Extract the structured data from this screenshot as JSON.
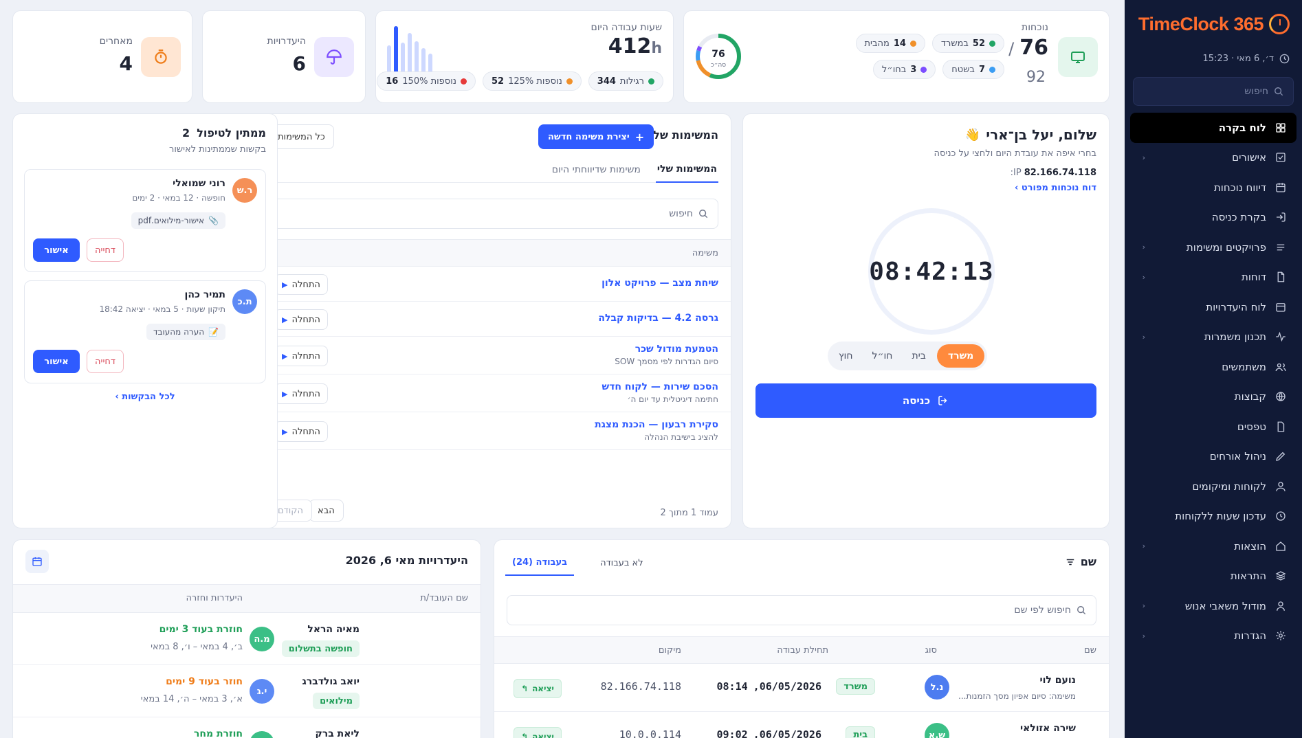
{
  "brand": {
    "name": "TimeClock 365"
  },
  "sidebar": {
    "datetime": "ד׳, 6 מאי · 15:23",
    "search_placeholder": "חיפוש",
    "items": [
      {
        "label": "לוח בקרה",
        "active": true,
        "has_sub": false
      },
      {
        "label": "אישורים",
        "has_sub": true
      },
      {
        "label": "דיווח נוכחות",
        "has_sub": false
      },
      {
        "label": "בקרת כניסה",
        "has_sub": false
      },
      {
        "label": "פרויקטים ומשימות",
        "has_sub": true
      },
      {
        "label": "דוחות",
        "has_sub": true
      },
      {
        "label": "לוח היעדרויות",
        "has_sub": false
      },
      {
        "label": "תכנון משמרות",
        "has_sub": true
      },
      {
        "label": "משתמשים",
        "has_sub": false
      },
      {
        "label": "קבוצות",
        "has_sub": false
      },
      {
        "label": "טפסים",
        "has_sub": false
      },
      {
        "label": "ניהול אורחים",
        "has_sub": false
      },
      {
        "label": "לקוחות ומיקומים",
        "has_sub": false
      },
      {
        "label": "עדכון שעות ללקוחות",
        "has_sub": false
      },
      {
        "label": "הוצאות",
        "has_sub": true
      },
      {
        "label": "התראות",
        "has_sub": false
      },
      {
        "label": "מודול משאבי אנוש",
        "has_sub": true
      },
      {
        "label": "הגדרות",
        "has_sub": true
      }
    ]
  },
  "stats": {
    "attendance": {
      "label": "נוכחות",
      "present": "76",
      "total": "92",
      "sep": "/",
      "ring_value": "76",
      "ring_label": "סה״כ",
      "pills": [
        {
          "label": "במשרד",
          "value": "52",
          "color": "#22a565"
        },
        {
          "label": "מהבית",
          "value": "14",
          "color": "#f0902a"
        },
        {
          "label": "בשטח",
          "value": "7",
          "color": "#3b9df3"
        },
        {
          "label": "בחו״ל",
          "value": "3",
          "color": "#7c4dff"
        }
      ]
    },
    "work_hours": {
      "label": "שעות עבודה היום",
      "value": "412",
      "unit": "h",
      "pills": [
        {
          "label": "רגילות",
          "value": "344",
          "color": "#22a565"
        },
        {
          "label": "נוספות 125%",
          "value": "52",
          "color": "#f0902a"
        },
        {
          "label": "נוספות 150%",
          "value": "16",
          "color": "#e63a3a"
        }
      ]
    },
    "absences": {
      "label": "היעדרויות",
      "value": "6"
    },
    "late": {
      "label": "מאחרים",
      "value": "4"
    }
  },
  "greeting": {
    "title": "שלום, יעל בן־ארי",
    "wave": "👋",
    "subtitle": "בחרי איפה את עובדת היום ולחצי על כניסה",
    "ip_label": "IP:",
    "ip": "82.166.74.118",
    "report_link": "דוח נוכחות מפורט ›",
    "clock": "08:42:13",
    "locations": [
      {
        "label": "משרד",
        "active": true
      },
      {
        "label": "בית"
      },
      {
        "label": "חו״ל"
      },
      {
        "label": "חוץ"
      }
    ],
    "enter_label": "כניסה"
  },
  "tasks": {
    "title": "המשימות שלי",
    "new_button": "יצירת משימה חדשה",
    "all_button": "כל המשימות",
    "tabs": [
      {
        "label": "המשימות שלי",
        "active": true
      },
      {
        "label": "משימות שדיווחתי היום"
      }
    ],
    "search_placeholder": "חיפוש",
    "column": "משימה",
    "start_label": "התחלה",
    "rows": [
      {
        "name": "שיחת מצב — פרויקט אלון",
        "desc": ""
      },
      {
        "name": "גרסה 4.2 — בדיקות קבלה",
        "desc": ""
      },
      {
        "name": "הטמעת מודול שכר",
        "desc": "סיום הגדרות לפי מסמך SOW"
      },
      {
        "name": "הסכם שירות — לקוח חדש",
        "desc": "חתימה דיגיטלית עד יום ה׳"
      },
      {
        "name": "סקירת רבעון — הכנת מצגת",
        "desc": "להציג בישיבת הנהלה"
      }
    ],
    "pagination": {
      "text": "עמוד 1 מתוך 2",
      "next": "הבא",
      "prev": "הקודם"
    }
  },
  "pending": {
    "title": "ממתין לטיפול",
    "count": "2",
    "subtitle": "בקשות שממתינות לאישור",
    "items": [
      {
        "initials": "ר.ש",
        "name": "רוני שמואלי",
        "detail": "חופשה · 12 במאי · 2 ימים",
        "attachment": "אישור-מילואים.pdf",
        "att_icon": "📎",
        "color": "#f59057"
      },
      {
        "initials": "ת.כ",
        "name": "תמיר כהן",
        "detail": "תיקון שעות · 5 במאי · יציאה 18:42",
        "attachment": "הערה מהעובד",
        "att_icon": "📝",
        "color": "#5d8af5"
      }
    ],
    "approve": "אישור",
    "reject": "דחייה",
    "all_link": "לכל הבקשות ›"
  },
  "employees": {
    "title": "שם",
    "tabs": [
      {
        "label": "בעבודה (24)",
        "active": true
      },
      {
        "label": "לא בעבודה"
      }
    ],
    "search_placeholder": "חיפוש לפי שם",
    "columns": [
      "שם",
      "סוג",
      "תחילת עבודה",
      "מיקום"
    ],
    "exit_label": "יציאה",
    "rows": [
      {
        "initials": "נ.ל",
        "name": "נועם לוי",
        "task": "משימה: סיום אפיון מסך הזמנות...",
        "type": "משרד",
        "start_date": "06/05/2026,",
        "start_time": "08:14",
        "ip": "82.166.74.118",
        "color": "#4d7cf0"
      },
      {
        "initials": "ש.א",
        "name": "שירה אזולאי",
        "task": "",
        "type": "בית",
        "start_date": "06/05/2026,",
        "start_time": "09:02",
        "ip": "10.0.0.114",
        "color": "#3bbf86"
      }
    ]
  },
  "absences_panel": {
    "title": "היעדרויות מאי 6, 2026",
    "columns": [
      "שם העובד/ת",
      "היעדרות וחזרה"
    ],
    "rows": [
      {
        "initials": "מ.ה",
        "name": "מאיה הראל",
        "tag": "חופשה בתשלום",
        "return": "חוזרת בעוד 3 ימים",
        "range": "ב׳, 4 במאי – ו׳, 8 במאי",
        "color": "#3bbf86",
        "ret_color": "#1e9e57"
      },
      {
        "initials": "י.ג",
        "name": "יואב גולדברג",
        "tag": "מילואים",
        "return": "חוזר בעוד 9 ימים",
        "range": "א׳, 3 במאי – ה׳, 14 במאי",
        "color": "#5d8af5",
        "ret_color": "#ef7d1a"
      },
      {
        "initials": "ל.ב",
        "name": "ליאת ברק",
        "tag": "",
        "return": "חוזרת מחר",
        "range": "",
        "color": "#3bbf86",
        "ret_color": "#1e9e57"
      }
    ]
  }
}
